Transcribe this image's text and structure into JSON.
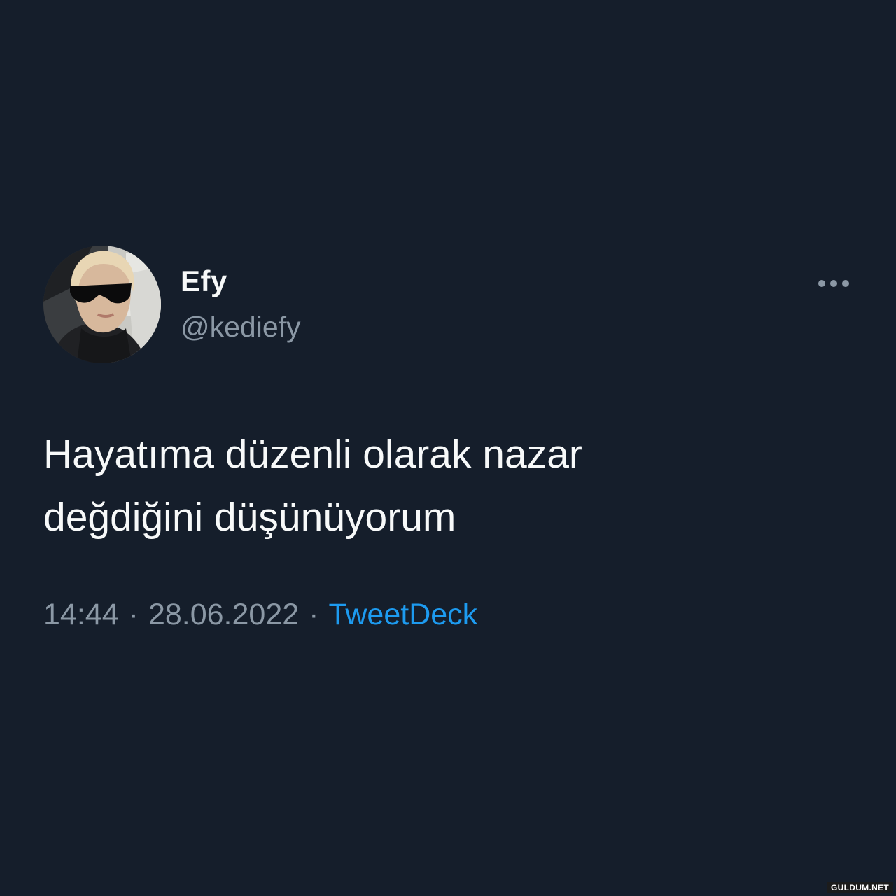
{
  "tweet": {
    "author": {
      "display_name": "Efy",
      "handle": "@kediefy"
    },
    "text": "Hayatıma düzenli olarak nazar\ndeğdiğini düşünüyorum",
    "time": "14:44",
    "separator": "·",
    "date": "28.06.2022",
    "source": "TweetDeck",
    "more_icon": "more-horizontal-icon"
  },
  "watermark": "GULDUM.NET",
  "colors": {
    "background": "#151e2b",
    "text_primary": "#f7f9f9",
    "text_secondary": "#8b98a5",
    "link": "#1d9bf0"
  }
}
